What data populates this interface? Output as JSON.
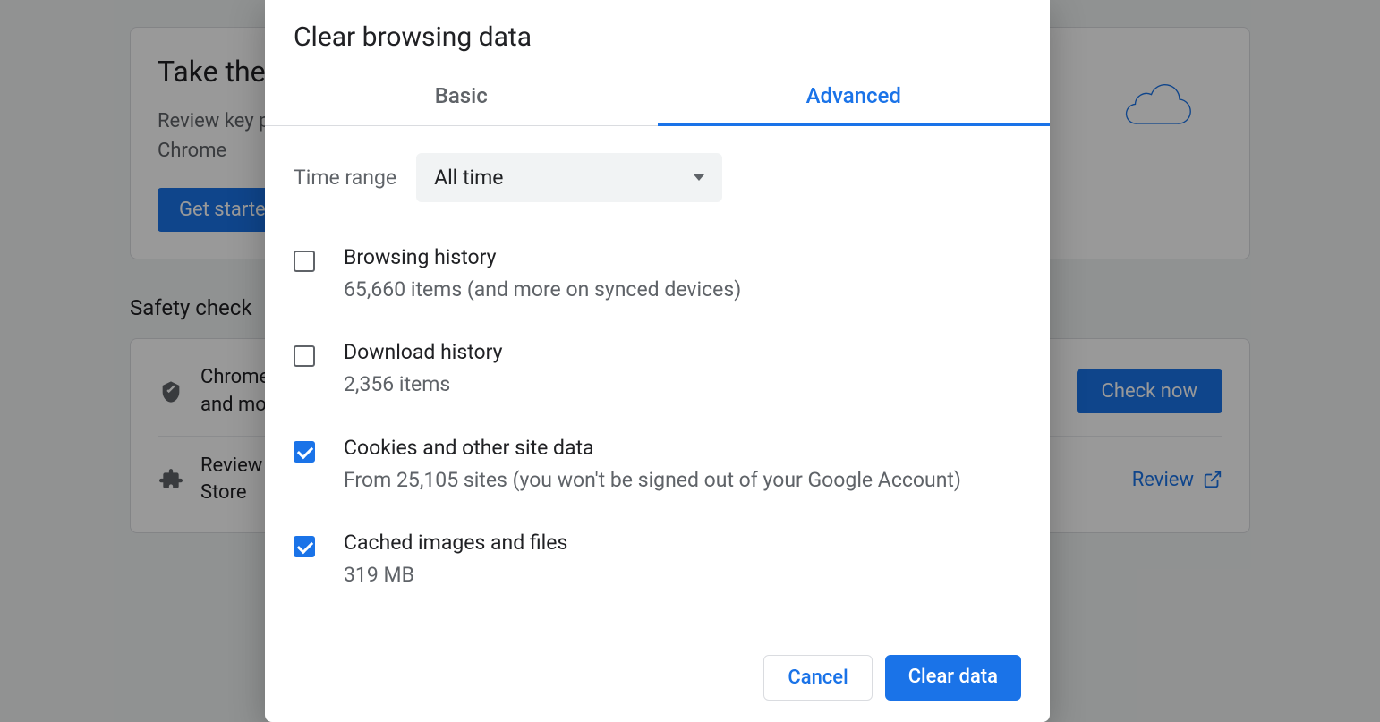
{
  "background": {
    "card1_title": "Take the Privacy Guide",
    "card1_desc_l1": "Review key privacy and security controls in",
    "card1_desc_l2": "Chrome",
    "card1_button": "Get started",
    "section_title": "Safety check",
    "row1_text_a": "Chrome can help keep you safe from data breaches, bad extensions,",
    "row1_text_b": "and more",
    "row1_action": "Check now",
    "row2_text_a": "Review  your  extensions  and  remove  any  that  aren't  from  the  Chrome  Web",
    "row2_text_b": "Store",
    "row2_action": "Review"
  },
  "dialog": {
    "title": "Clear browsing data",
    "tabs": {
      "basic": "Basic",
      "advanced": "Advanced"
    },
    "time_label": "Time range",
    "time_value": "All time",
    "options": [
      {
        "title": "Browsing history",
        "sub": "65,660 items (and more on synced devices)",
        "checked": false
      },
      {
        "title": "Download history",
        "sub": "2,356 items",
        "checked": false
      },
      {
        "title": "Cookies and other site data",
        "sub": "From 25,105 sites (you won't be signed out of your Google Account)",
        "checked": true
      },
      {
        "title": "Cached images and files",
        "sub": "319 MB",
        "checked": true
      }
    ],
    "cancel": "Cancel",
    "clear": "Clear data"
  }
}
